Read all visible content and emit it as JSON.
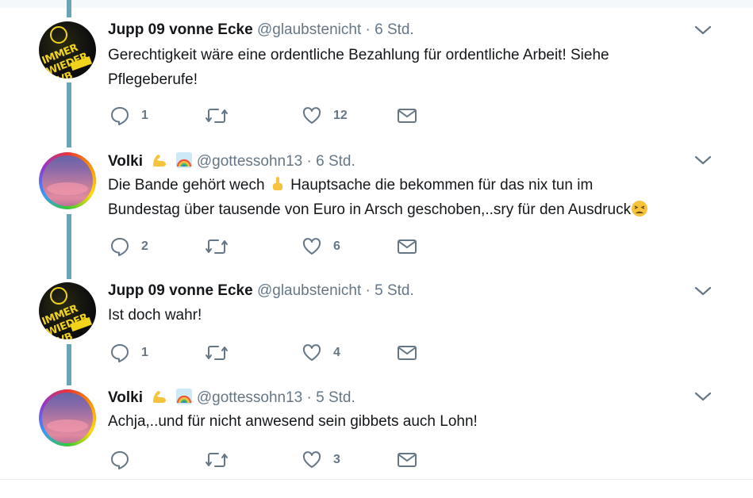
{
  "tweets": [
    {
      "name": "Jupp 09 vonne Ecke",
      "handle": "@glaubstenicht",
      "dot": "·",
      "time": "6 Std.",
      "text_line1": "Gerechtigkeit wäre eine ordentliche Bezahlung für ordentliche Arbeit! Siehe",
      "text_line2": "Pflegeberufe!",
      "replies": "1",
      "retweets": "",
      "likes": "12",
      "avatar": "bvb-avatar"
    },
    {
      "name": "Volki",
      "name_emojis": [
        "flexed-biceps-emoji",
        "rainbow-emoji"
      ],
      "handle": "@gottessohn13",
      "dot": "·",
      "time": "6 Std.",
      "text_line1a": "Die Bande gehört wech",
      "text_line1b": "Hauptsache die bekommen für das nix tun im",
      "text_line2": "Bundestag über tausende von Euro in Arsch geschoben,..sry für den Ausdruck",
      "inline_emojis": [
        "pointing-up-emoji",
        "tired-face-emoji"
      ],
      "replies": "2",
      "retweets": "",
      "likes": "6",
      "avatar": "rainbow-sky-avatar"
    },
    {
      "name": "Jupp 09 vonne Ecke",
      "handle": "@glaubstenicht",
      "dot": "·",
      "time": "5 Std.",
      "text_line1": "Ist doch wahr!",
      "replies": "1",
      "retweets": "",
      "likes": "4",
      "avatar": "bvb-avatar"
    },
    {
      "name": "Volki",
      "name_emojis": [
        "flexed-biceps-emoji",
        "rainbow-emoji"
      ],
      "handle": "@gottessohn13",
      "dot": "·",
      "time": "5 Std.",
      "text_line1": "Achja,..und für nicht anwesend sein gibbets auch Lohn!",
      "replies": "",
      "retweets": "",
      "likes": "3",
      "avatar": "rainbow-sky-avatar"
    }
  ],
  "avatar_bvb_text": "IMMER WIEDER BVB",
  "colors": {
    "thread_line": "#6aa4b8",
    "icon_gray": "#657786",
    "text": "#14171a"
  }
}
